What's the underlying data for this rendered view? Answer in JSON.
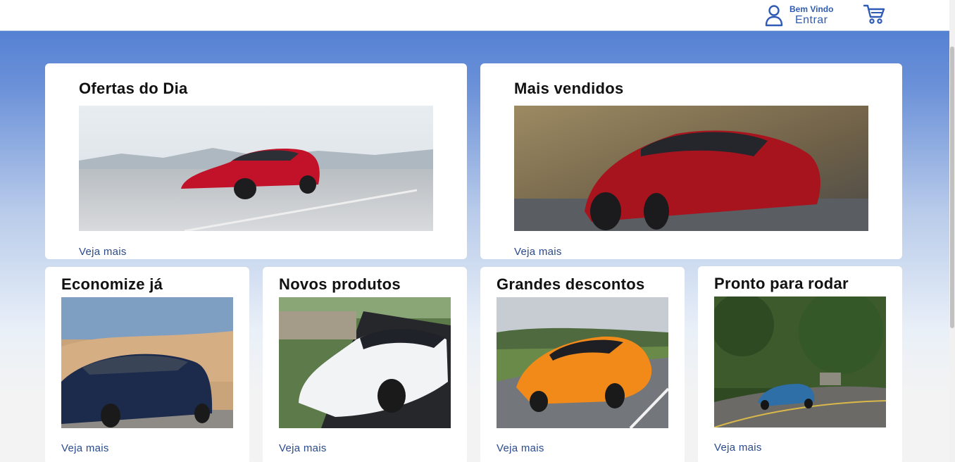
{
  "header": {
    "welcome": "Bem Vindo",
    "login": "Entrar",
    "accent_color": "#2f5bb7",
    "icons": [
      "user-icon",
      "cart-icon"
    ]
  },
  "cards": {
    "deals": {
      "title": "Ofertas do Dia",
      "link": "Veja mais"
    },
    "bestsellers": {
      "title": "Mais vendidos",
      "link": "Veja mais"
    },
    "save": {
      "title": "Economize já",
      "link": "Veja mais"
    },
    "new_products": {
      "title": "Novos produtos",
      "link": "Veja mais"
    },
    "big_discounts": {
      "title": "Grandes descontos",
      "link": "Veja mais"
    },
    "ready": {
      "title": "Pronto para rodar",
      "link": "Veja mais"
    }
  },
  "colors": {
    "link": "#2a4a8c",
    "background_top": "#4a79d0",
    "background_bottom": "#f3f3f3"
  }
}
